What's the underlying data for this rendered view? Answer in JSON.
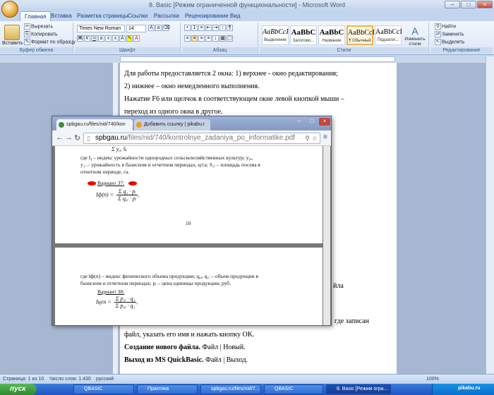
{
  "word": {
    "title": "8. Basic [Режим ограниченной функциональности] - Microsoft Word",
    "tabs": [
      "Главная",
      "Вставка",
      "Разметка страницы",
      "Ссылки",
      "Рассылки",
      "Рецензирование",
      "Вид"
    ],
    "clipboard": {
      "paste": "Вставить",
      "cut": "Вырезать",
      "copy": "Копировать",
      "format_painter": "Формат по образцу",
      "label": "Буфер обмена"
    },
    "font": {
      "name": "Times New Roman",
      "size": "14",
      "label": "Шрифт"
    },
    "paragraph_label": "Абзац",
    "styles": {
      "items": [
        {
          "sample": "AaBbCcI",
          "name": "Выделение"
        },
        {
          "sample": "AaBbC",
          "name": "Заголово..."
        },
        {
          "sample": "AaBbC",
          "name": "Название"
        },
        {
          "sample": "AaBbCcI",
          "name": "¶ Обычный"
        },
        {
          "sample": "AaBbCcI",
          "name": "Подзагол..."
        }
      ],
      "change_styles": "Изменить стили",
      "label": "Стили"
    },
    "editing": {
      "find": "Найти",
      "replace": "Заменить",
      "select": "Выделить",
      "label": "Редактирование"
    },
    "doc_lines": [
      "Для работы предоставляется 2 окна: 1) верхнее - окно редактирования;",
      "2) нижнее – окно немедленного выполнения.",
      "Нажатие F6 или щелчок в соответствующем окне левой кнопкой мыши –",
      "переход из одного окна в другое."
    ],
    "doc_lines_bottom": [
      "где записан",
      "файл, указать его имя  и нажать кнопку OK."
    ],
    "bold_line1": "Создание нового файла.",
    "bold_line1_rest": " Файл | Новый.",
    "bold_line2": "Выход из MS QuickBasic.",
    "bold_line2_rest": " Файл | Выход.",
    "fragment_right": "йла",
    "status": {
      "page": "Страница: 1 из 10",
      "words": "Число слов: 1 430",
      "lang": "русский",
      "zoom": "100%"
    }
  },
  "browser": {
    "tabs": [
      {
        "title": "spbgau.ru/files/nid/740/kon"
      },
      {
        "title": "Добавить ссылку | pikabu.r"
      }
    ],
    "url_host": "spbgau.ru",
    "url_path": "/files/nid/740/kontrolnye_zadaniya_po_informatike.pdf",
    "page1": {
      "sum_top": "Σ y₀ᵢ Sᵢ",
      "para1": "где Iᵧ – индекс урожайности однородных сельскохозяйственных культур; y₀ᵢ,",
      "para2": "y₁ᵢ – урожайность в базисном и отчетном периодах, ц/га; S₁ᵢ – площадь посева в",
      "para3": "отчетном периоде, га.",
      "variant": "Вариант 37:",
      "formula_lhs": "Iф(п) =",
      "num": "Σ q₁ · pᵢ",
      "den": "Σ q₀ᵢ · pᵢ",
      "page_number": "10"
    },
    "page2": {
      "para1": "где Iф(п) – индекс физического объема продукции; q₀ᵢ, q₁ᵢ – объем продукции в",
      "para2": "базисном и отчетном периодах; pᵢ – цена единицы продукции, руб.",
      "variant": "Вариант 38:",
      "formula_lhs": "Iцен =",
      "num": "Σ p₁ᵢ · q₁",
      "den": "Σ p₀ᵢ · q₁"
    }
  },
  "taskbar": {
    "start": "пуск",
    "items": [
      "QBASIC",
      "Практика",
      "spbgau.ru/files/nid/7...",
      "QBASIC",
      "8. Basic [Режим огра..."
    ],
    "clock": "16:..."
  },
  "watermark": "pikabu.ru"
}
